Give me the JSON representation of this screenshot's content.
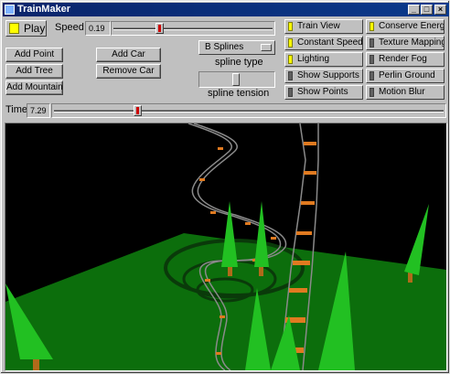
{
  "window": {
    "title": "TrainMaker"
  },
  "controls": {
    "play_label": "Play",
    "speed_label": "Speed",
    "speed_value": "0.19",
    "speed_fraction": 0.28,
    "time_label": "Time",
    "time_value": "7.29",
    "time_fraction": 0.21,
    "add_point": "Add Point",
    "add_tree": "Add Tree",
    "add_mountain": "Add Mountain",
    "add_car": "Add Car",
    "remove_car": "Remove Car",
    "spline_selected": "B Splines",
    "spline_type_label": "spline type",
    "spline_tension_label": "spline tension",
    "spline_tension_fraction": 0.5
  },
  "toggles": [
    {
      "label": "Train View",
      "on": true
    },
    {
      "label": "Constant Speed",
      "on": true
    },
    {
      "label": "Lighting",
      "on": true
    },
    {
      "label": "Show Supports",
      "on": false
    },
    {
      "label": "Show Points",
      "on": false
    },
    {
      "label": "Conserve Energy",
      "on": true
    },
    {
      "label": "Texture Mapping",
      "on": false
    },
    {
      "label": "Render Fog",
      "on": false
    },
    {
      "label": "Perlin Ground",
      "on": false
    },
    {
      "label": "Motion Blur",
      "on": false
    }
  ],
  "colors": {
    "ground": "#0c6e0c",
    "trees": "#22c022",
    "trunk": "#b06a1a",
    "rail": "#8a8a8a",
    "ties": "#e07a20",
    "led_on": "#ffff00"
  }
}
